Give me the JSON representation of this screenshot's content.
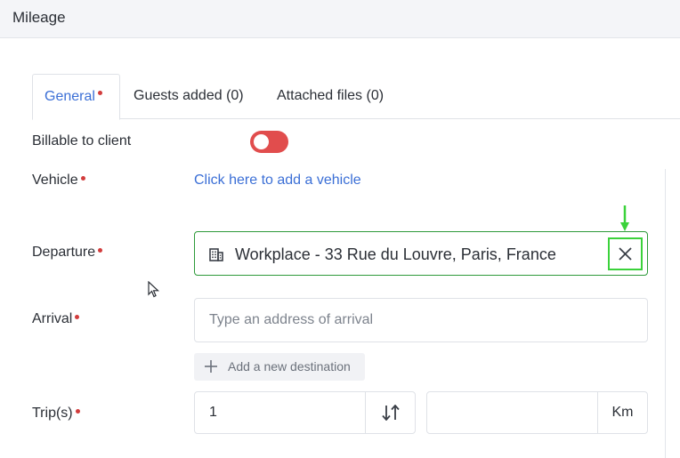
{
  "header": {
    "title": "Mileage"
  },
  "tabs": [
    {
      "label": "General",
      "required": true,
      "active": true
    },
    {
      "label": "Guests added (0)"
    },
    {
      "label": "Attached files (0)"
    }
  ],
  "form": {
    "billable": {
      "label": "Billable to client",
      "toggle_on": false,
      "toggle_color": "#e14d4d"
    },
    "vehicle": {
      "label": "Vehicle",
      "link_text": "Click here to add a vehicle"
    },
    "departure": {
      "label": "Departure",
      "value": "Workplace - 33 Rue du Louvre, Paris, France",
      "icon": "building-icon",
      "clear_icon": "close-icon"
    },
    "arrival": {
      "label": "Arrival",
      "placeholder": "Type an address of arrival"
    },
    "add_destination": {
      "label": "Add a new destination",
      "icon": "plus-icon"
    },
    "trips": {
      "label": "Trip(s)",
      "value": "1",
      "swap_icon": "swap-vertical-icon",
      "distance_value": "",
      "distance_unit": "Km"
    }
  },
  "colors": {
    "accent": "#3b6fd6",
    "required": "#d23c3c",
    "valid_border": "#2e9a3a",
    "highlight": "#3bd23b"
  }
}
